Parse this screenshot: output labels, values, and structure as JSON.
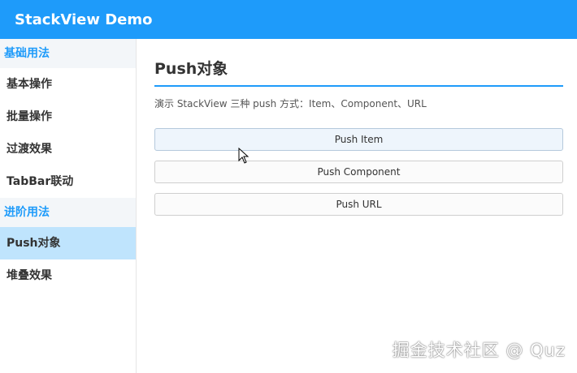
{
  "app": {
    "title": "StackView Demo"
  },
  "sidebar": {
    "groups": [
      {
        "title": "基础用法",
        "items": [
          {
            "label": "基本操作"
          },
          {
            "label": "批量操作"
          },
          {
            "label": "过渡效果"
          },
          {
            "label": "TabBar联动"
          }
        ]
      },
      {
        "title": "进阶用法",
        "items": [
          {
            "label": "Push对象",
            "active": true
          },
          {
            "label": "堆叠效果"
          }
        ]
      }
    ]
  },
  "main": {
    "title": "Push对象",
    "description": "演示 StackView 三种 push 方式：Item、Component、URL",
    "buttons": [
      {
        "label": "Push Item"
      },
      {
        "label": "Push Component"
      },
      {
        "label": "Push URL"
      }
    ]
  },
  "watermark": "掘金技术社区 @ Quz",
  "colors": {
    "accent": "#1e9bfa",
    "active_item_bg": "#bfe4fd",
    "group_bg": "#f3f6f9"
  }
}
